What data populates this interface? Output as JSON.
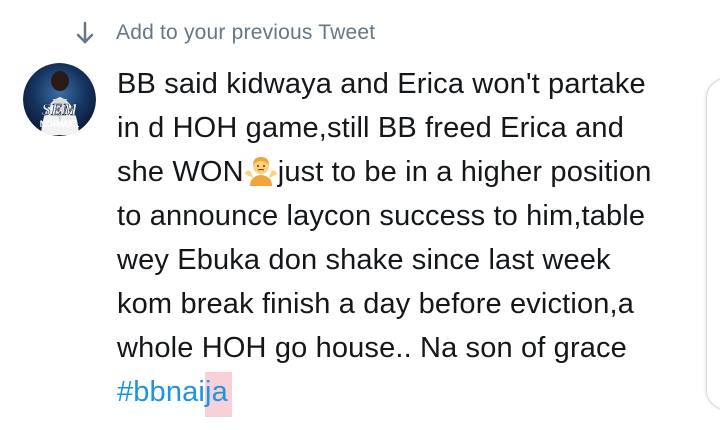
{
  "header": {
    "label": "Add to your previous Tweet",
    "icon": "arrow-down-icon"
  },
  "tweet": {
    "avatar": {
      "icon": "profile-avatar",
      "lettering": "SEM NORMAL"
    },
    "lines": [
      "BB said kidwaya and Erica won't partake",
      "in d HOH game,still BB freed Erica and",
      "she WON",
      "just to be in a higher position",
      "to announce laycon success to him,table",
      "wey Ebuka don shake since last week",
      "kom break finish a day before eviction,a",
      "whole HOH go house.. Na son of grace"
    ],
    "emoji": "person-shrugging-emoji",
    "hashtag_main": "#bbnai",
    "hashtag_selected": "ja"
  },
  "colors": {
    "text": "#14171a",
    "secondary": "#657786",
    "hashtag": "#1b95e0",
    "selection": "#f7d0d8"
  }
}
